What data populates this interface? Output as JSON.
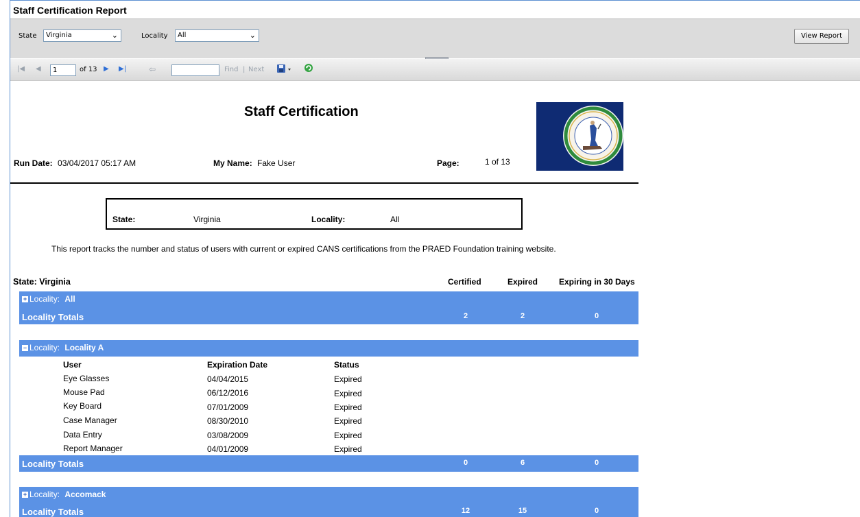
{
  "window": {
    "title": "Staff Certification Report"
  },
  "params": {
    "state_label": "State",
    "state_value": "Virginia",
    "locality_label": "Locality",
    "locality_value": "All",
    "view_button": "View Report"
  },
  "toolbar": {
    "page_current": "1",
    "page_of": "of 13",
    "find_label": "Find",
    "separator": "|",
    "next_label": "Next"
  },
  "report": {
    "title": "Staff Certification",
    "run_date_label": "Run Date:",
    "run_date_value": "03/04/2017  05:17 AM",
    "my_name_label": "My Name:",
    "my_name_value": "Fake User",
    "page_label": "Page:",
    "page_value": "1 of 13",
    "filter": {
      "state_label": "State:",
      "state_value": "Virginia",
      "locality_label": "Locality:",
      "locality_value": "All"
    },
    "description": "This report tracks the number and status of users with current or expired CANS certifications from the PRAED Foundation training website.",
    "state_heading": "State:  Virginia",
    "col_certified": "Certified",
    "col_expired": "Expired",
    "col_expiring": "Expiring in 30 Days",
    "locality_prefix": "Locality:",
    "totals_label": "Locality Totals",
    "groups": [
      {
        "name": "All",
        "certified": "2",
        "expired": "2",
        "expiring": "0"
      },
      {
        "name": "Locality A",
        "certified": "0",
        "expired": "6",
        "expiring": "0",
        "headers": {
          "user": "User",
          "expiration": "Expiration Date",
          "status": "Status"
        },
        "rows": [
          {
            "user": "Eye Glasses",
            "date": "04/04/2015",
            "status": "Expired"
          },
          {
            "user": "Mouse Pad",
            "date": "06/12/2016",
            "status": "Expired"
          },
          {
            "user": "Key Board",
            "date": "07/01/2009",
            "status": "Expired"
          },
          {
            "user": "Case Manager",
            "date": "08/30/2010",
            "status": "Expired"
          },
          {
            "user": "Data Entry",
            "date": "03/08/2009",
            "status": "Expired"
          },
          {
            "user": "Report Manager",
            "date": "04/01/2009",
            "status": "Expired"
          }
        ]
      },
      {
        "name": "Accomack",
        "certified": "12",
        "expired": "15",
        "expiring": "0"
      }
    ]
  },
  "icons": {
    "first_page": "first-page-icon",
    "prev_page": "previous-page-icon",
    "next_page": "next-page-icon",
    "last_page": "last-page-icon",
    "back": "back-icon",
    "export": "export-save-icon",
    "refresh": "refresh-icon",
    "seal": "virginia-seal-logo"
  },
  "colors": {
    "band": "#5b92e5",
    "seal_bg": "#0f2b73",
    "frame": "#5b8fd1"
  }
}
